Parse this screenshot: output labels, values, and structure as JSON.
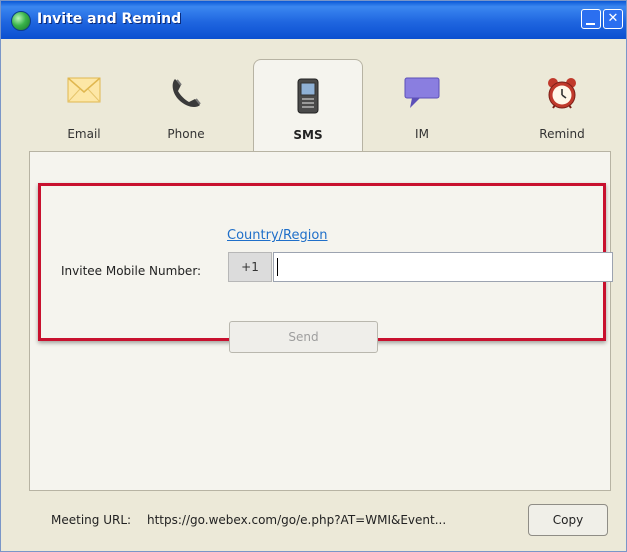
{
  "window": {
    "title": "Invite and Remind",
    "controls": {
      "minimize_icon": "minimize-icon",
      "close_icon": "close-icon"
    }
  },
  "tabs": [
    {
      "label": "Email",
      "icon": "envelope-icon",
      "active": false
    },
    {
      "label": "Phone",
      "icon": "phone-handset-icon",
      "active": false
    },
    {
      "label": "SMS",
      "icon": "mobile-phone-icon",
      "active": true
    },
    {
      "label": "IM",
      "icon": "speech-bubble-icon",
      "active": false
    },
    {
      "label": "Remind",
      "icon": "alarm-clock-icon",
      "active": false
    }
  ],
  "sms": {
    "country_link": "Country/Region",
    "mobile_label": "Invitee Mobile Number:",
    "country_code": "+1",
    "number_value": "",
    "send_label": "Send"
  },
  "footer": {
    "meeting_url_label": "Meeting URL:",
    "meeting_url": "https://go.webex.com/go/e.php?AT=WMI&Event...",
    "copy_label": "Copy"
  },
  "colors": {
    "titlebar": "#0b4fd0",
    "highlight_border": "#c8102e",
    "link": "#1f6fc9",
    "window_bg": "#ece9d8"
  }
}
